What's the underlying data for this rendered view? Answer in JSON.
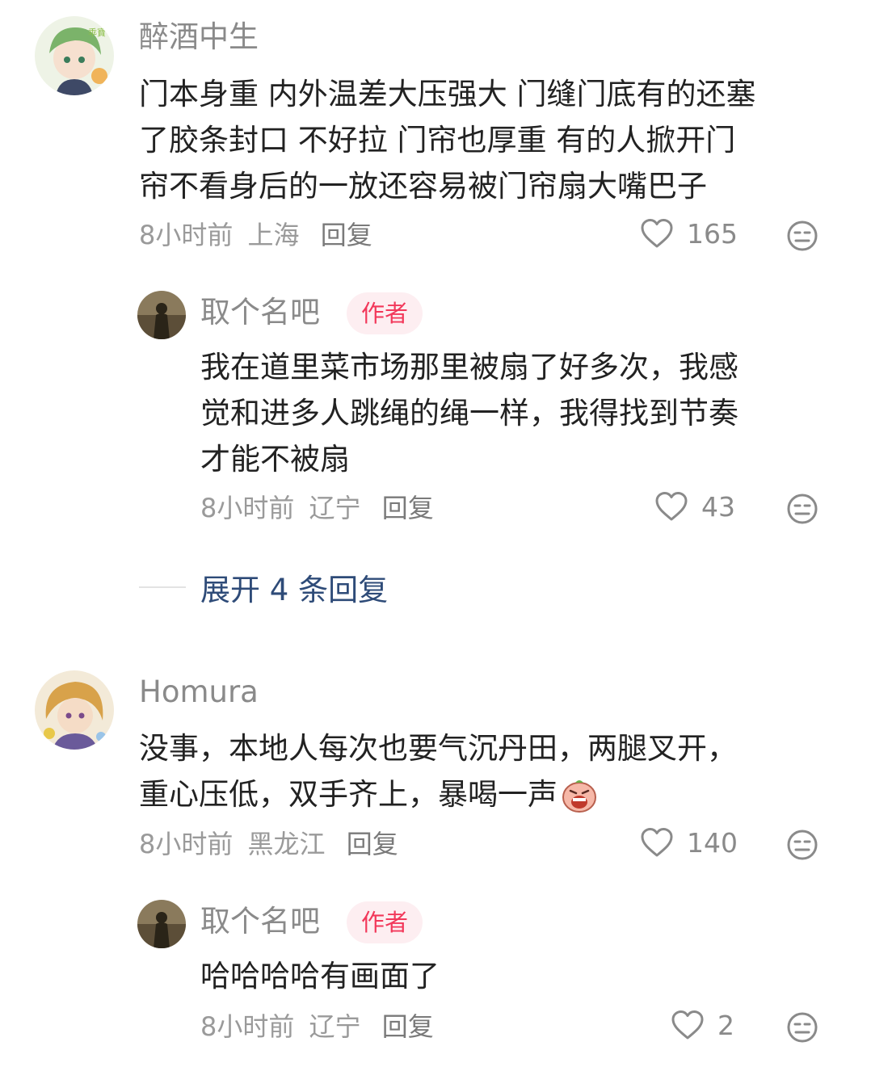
{
  "comments": [
    {
      "username": "醉酒中生",
      "avatar_icon": "anime-avatar-green-hair",
      "lines": [
        "门本身重 内外温差大压强大 门缝门底有的还塞",
        "了胶条封口 不好拉 门帘也厚重 有的人掀开门",
        "帘不看身后的一放还容易被门帘扇大嘴巴子"
      ],
      "time": "8小时前",
      "location": "上海",
      "reply_label": "回复",
      "likes": "165",
      "replies": [
        {
          "username": "取个名吧",
          "badge": "作者",
          "avatar_icon": "silhouette-photo-avatar",
          "lines": [
            "我在道里菜市场那里被扇了好多次，我感",
            "觉和进多人跳绳的绳一样，我得找到节奏",
            "才能不被扇"
          ],
          "time": "8小时前",
          "location": "辽宁",
          "reply_label": "回复",
          "likes": "43"
        }
      ],
      "expand_label": "展开 4 条回复"
    },
    {
      "username": "Homura",
      "avatar_icon": "anime-avatar-blonde-hair",
      "lines": [
        "没事，本地人每次也要气沉丹田，两腿叉开，",
        "重心压低，双手齐上，暴喝一声"
      ],
      "emoji_icon": "shouting-face-emoji",
      "time": "8小时前",
      "location": "黑龙江",
      "reply_label": "回复",
      "likes": "140",
      "replies": [
        {
          "username": "取个名吧",
          "badge": "作者",
          "avatar_icon": "silhouette-photo-avatar",
          "lines": [
            "哈哈哈哈有画面了"
          ],
          "time": "8小时前",
          "location": "辽宁",
          "reply_label": "回复",
          "likes": "2"
        }
      ]
    }
  ],
  "icons": {
    "like": "heart-outline-icon",
    "dislike": "meh-face-icon"
  },
  "colors": {
    "username": "#8a8a8a",
    "author_badge_text": "#f2385a",
    "author_badge_bg": "#fdeef1",
    "expand_link": "#2e4b78"
  }
}
